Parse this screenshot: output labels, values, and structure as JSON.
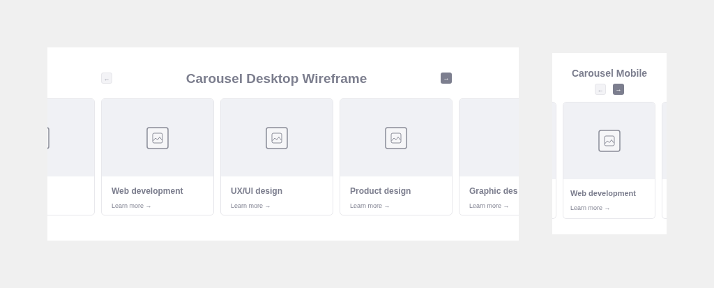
{
  "desktop": {
    "title": "Carousel Desktop Wireframe",
    "prev_button": {
      "icon": "←",
      "disabled": true
    },
    "next_button": {
      "icon": "→",
      "disabled": false
    },
    "cards": [
      {
        "kind": "partial"
      },
      {
        "kind": "full",
        "title": "Web development",
        "link": "Learn more →"
      },
      {
        "kind": "full",
        "title": "UX/UI design",
        "link": "Learn more →"
      },
      {
        "kind": "full",
        "title": "Product design",
        "link": "Learn more →"
      },
      {
        "kind": "cut",
        "title": "Graphic des",
        "link": "Learn more →"
      }
    ]
  },
  "mobile": {
    "title": "Carousel Mobile",
    "prev_button": {
      "icon": "←",
      "disabled": true
    },
    "next_button": {
      "icon": "→",
      "disabled": false
    },
    "cards": [
      {
        "kind": "edge"
      },
      {
        "kind": "full",
        "title": "Web development",
        "link": "Learn more →"
      },
      {
        "kind": "edge"
      }
    ]
  }
}
